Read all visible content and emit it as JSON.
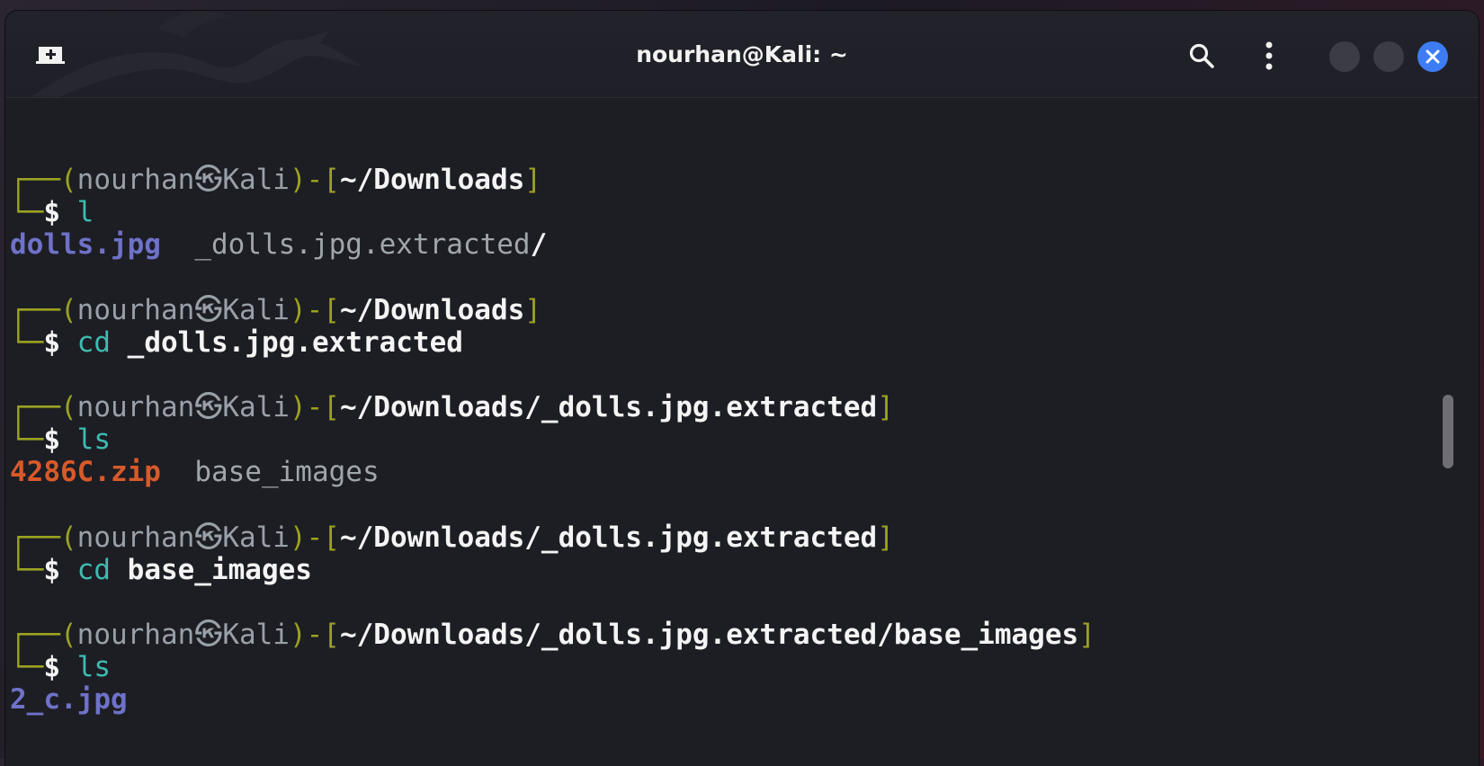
{
  "window": {
    "title": "nourhan@Kali: ~",
    "accent": "#3d7cf3"
  },
  "icons": {
    "new_tab": "new-tab-icon",
    "search": "search-icon",
    "menu": "kebab-menu-icon",
    "close": "close-icon"
  },
  "terminal": {
    "prompts": [
      {
        "user": "nourhan",
        "host": "Kali",
        "cwd": "~/Downloads",
        "cmd": "l",
        "arg": ""
      },
      {
        "user": "nourhan",
        "host": "Kali",
        "cwd": "~/Downloads",
        "cmd": "cd",
        "arg": "_dolls.jpg.extracted"
      },
      {
        "user": "nourhan",
        "host": "Kali",
        "cwd": "~/Downloads/_dolls.jpg.extracted",
        "cmd": "ls",
        "arg": ""
      },
      {
        "user": "nourhan",
        "host": "Kali",
        "cwd": "~/Downloads/_dolls.jpg.extracted",
        "cmd": "cd",
        "arg": "base_images"
      },
      {
        "user": "nourhan",
        "host": "Kali",
        "cwd": "~/Downloads/_dolls.jpg.extracted/base_images",
        "cmd": "ls",
        "arg": ""
      }
    ],
    "outputs": {
      "o1_file": "dolls.jpg",
      "o1_dir": "_dolls.jpg.extracted",
      "o1_slash": "/",
      "o3_zip": "4286C.zip",
      "o3_dir": "base_images",
      "o5_file": "2_c.jpg"
    },
    "colors": {
      "frame": "#9aa221",
      "command": "#3dbbb0",
      "image_file": "#6e72c8",
      "archive_file": "#d75a2a"
    }
  }
}
